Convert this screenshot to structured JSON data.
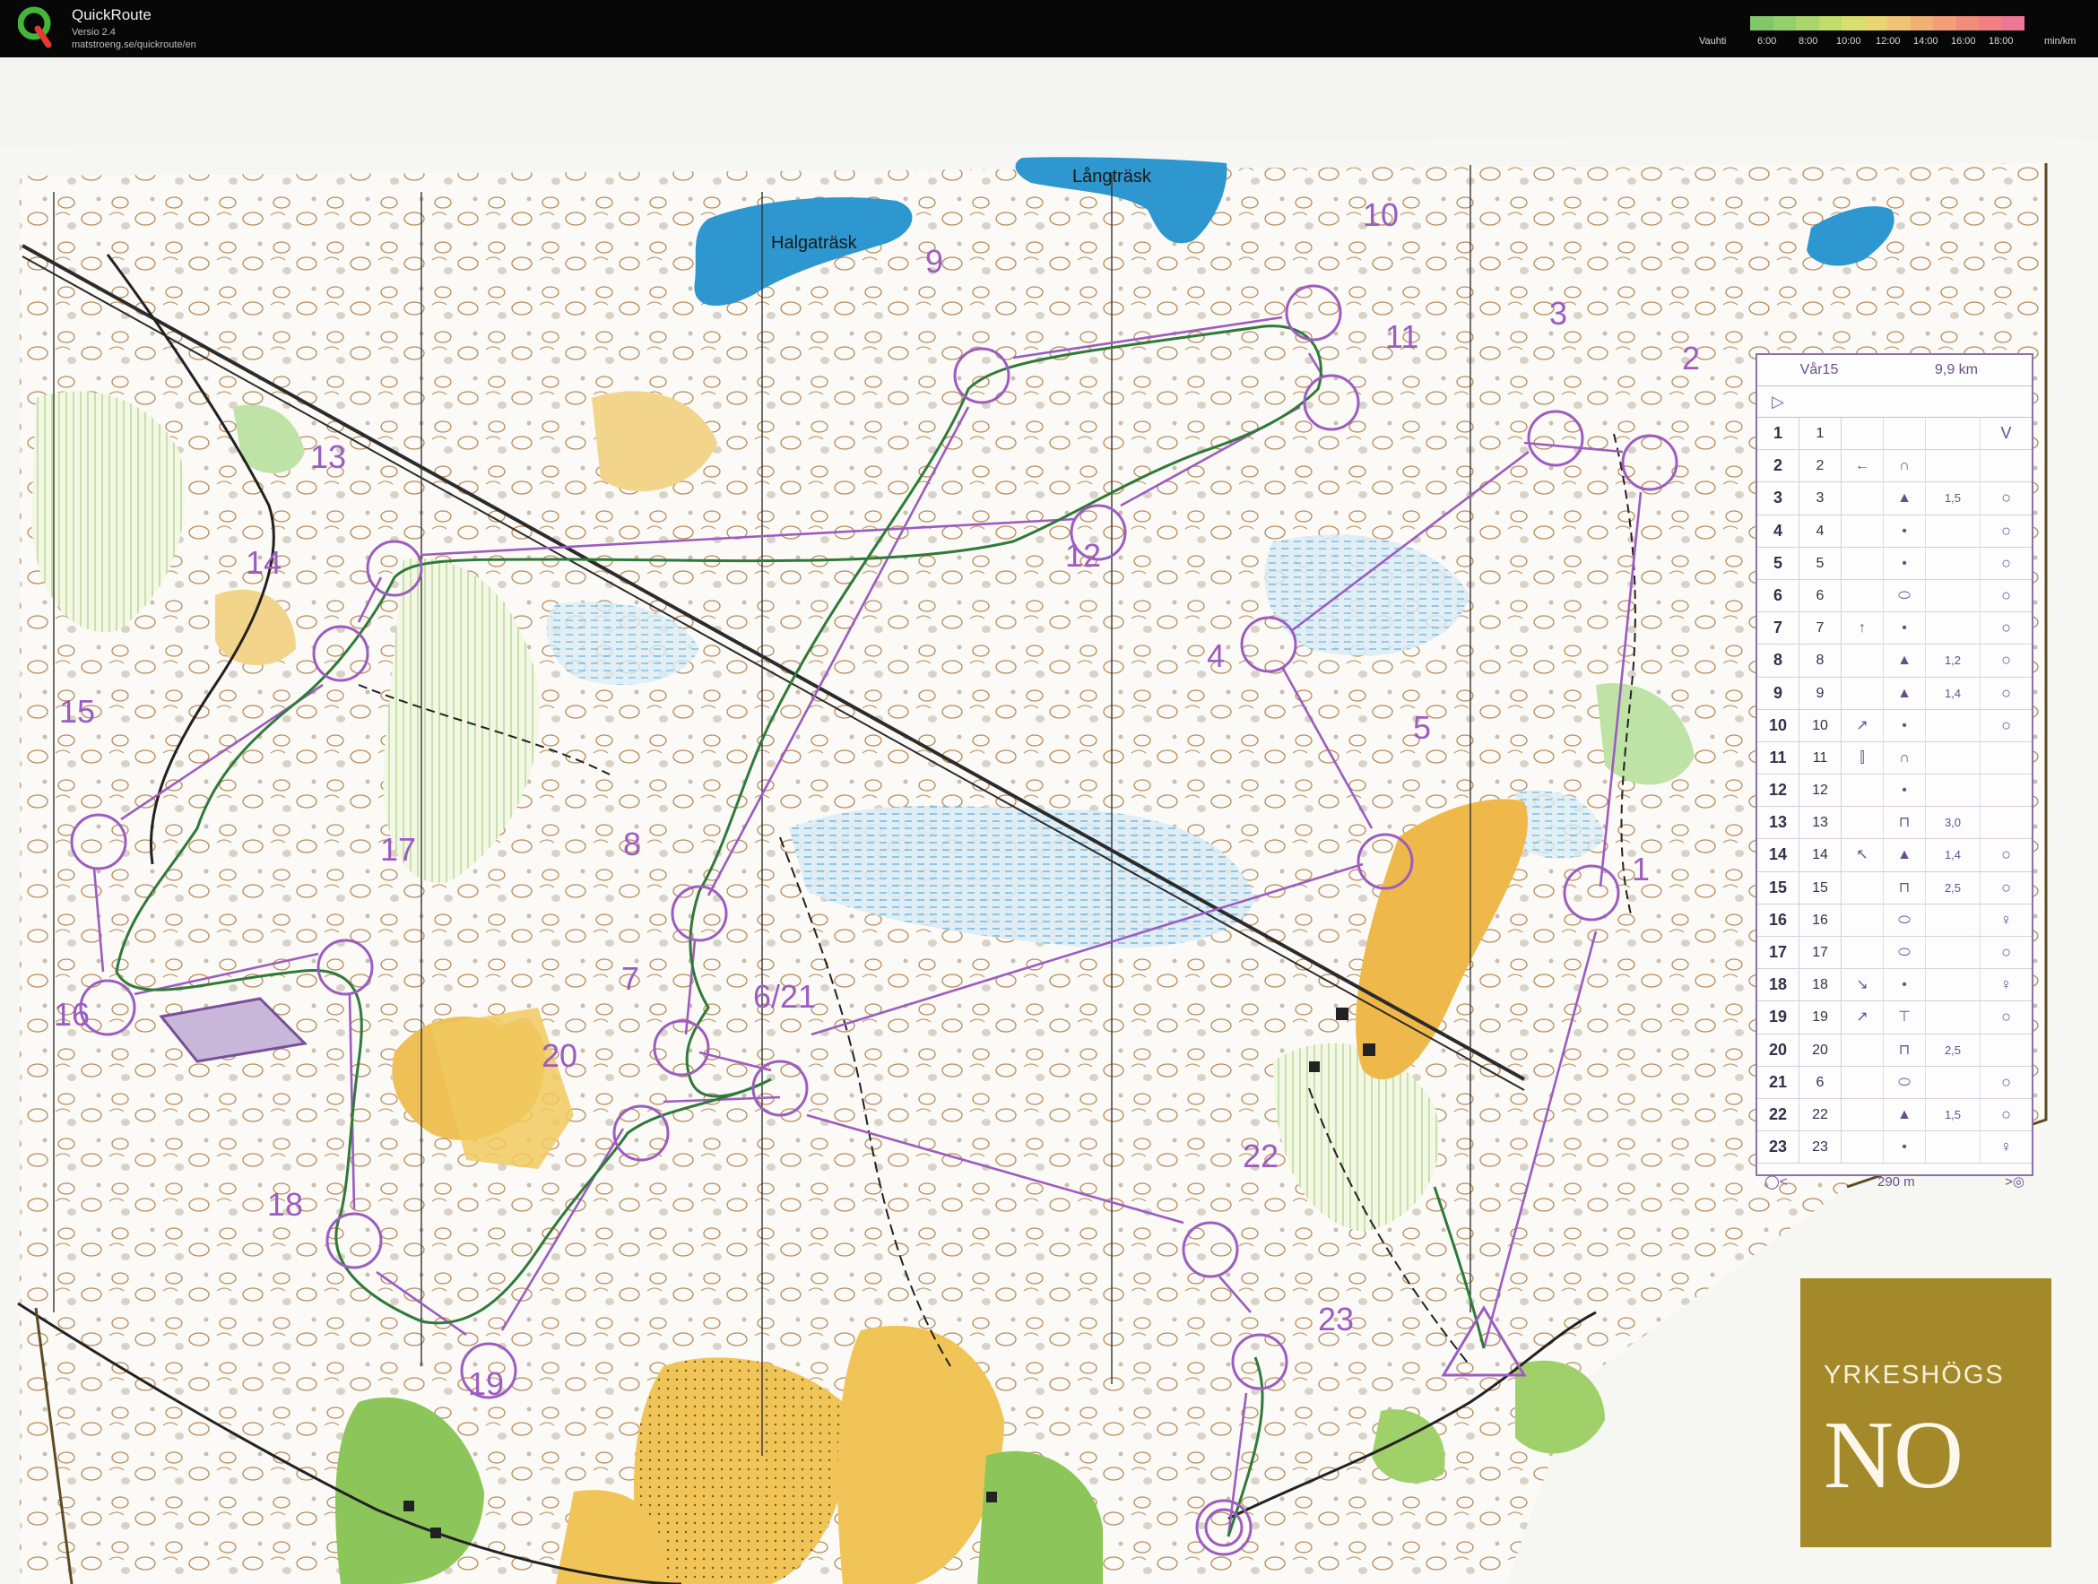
{
  "app": {
    "name": "QuickRoute",
    "version": "Versio 2.4",
    "url": "matstroeng.se/quickroute/en"
  },
  "pace_scale": {
    "label": "Vauhti",
    "ticks": [
      "6:00",
      "8:00",
      "10:00",
      "12:00",
      "14:00",
      "16:00",
      "18:00"
    ],
    "unit": "min/km",
    "colors": [
      "#7ec76a",
      "#93cf6a",
      "#a9d66a",
      "#c2dc6b",
      "#d9df6e",
      "#e8d673",
      "#efc474",
      "#f1b175",
      "#f29e77",
      "#f38d7b",
      "#f17f84",
      "#ee7692"
    ]
  },
  "map": {
    "lake_labels": [
      "Halgaträsk",
      "Långträsk"
    ],
    "controls": [
      "1",
      "2",
      "3",
      "4",
      "5",
      "6/21",
      "7",
      "8",
      "9",
      "10",
      "11",
      "12",
      "13",
      "14",
      "15",
      "16",
      "17",
      "18",
      "19",
      "20",
      "22",
      "23"
    ],
    "colors": {
      "course": "#9c5cc0",
      "route": "#2f7a3a",
      "water": "#3a9fd0",
      "marsh": "#a9d3ea",
      "open": "#e8b74a",
      "vegetation": "#8cc65a"
    }
  },
  "control_table": {
    "course": "Vår15",
    "length": "9,9 km",
    "rows": [
      {
        "no": "1",
        "code": "1",
        "sym": "",
        "feat": "",
        "dim": "",
        "loc": "V"
      },
      {
        "no": "2",
        "code": "2",
        "sym": "←",
        "feat": "∩",
        "dim": "",
        "loc": ""
      },
      {
        "no": "3",
        "code": "3",
        "sym": "",
        "feat": "▲",
        "dim": "1,5",
        "loc": "○"
      },
      {
        "no": "4",
        "code": "4",
        "sym": "",
        "feat": "•",
        "dim": "",
        "loc": "○"
      },
      {
        "no": "5",
        "code": "5",
        "sym": "",
        "feat": "•",
        "dim": "",
        "loc": "○"
      },
      {
        "no": "6",
        "code": "6",
        "sym": "",
        "feat": "⬭",
        "dim": "",
        "loc": "○"
      },
      {
        "no": "7",
        "code": "7",
        "sym": "↑",
        "feat": "•",
        "dim": "",
        "loc": "○"
      },
      {
        "no": "8",
        "code": "8",
        "sym": "",
        "feat": "▲",
        "dim": "1,2",
        "loc": "○"
      },
      {
        "no": "9",
        "code": "9",
        "sym": "",
        "feat": "▲",
        "dim": "1,4",
        "loc": "○"
      },
      {
        "no": "10",
        "code": "10",
        "sym": "↗",
        "feat": "•",
        "dim": "",
        "loc": "○"
      },
      {
        "no": "11",
        "code": "11",
        "sym": "⫿",
        "feat": "∩",
        "dim": "",
        "loc": ""
      },
      {
        "no": "12",
        "code": "12",
        "sym": "",
        "feat": "•",
        "dim": "",
        "loc": ""
      },
      {
        "no": "13",
        "code": "13",
        "sym": "",
        "feat": "⊓",
        "dim": "3,0",
        "loc": ""
      },
      {
        "no": "14",
        "code": "14",
        "sym": "↖",
        "feat": "▲",
        "dim": "1,4",
        "loc": "○"
      },
      {
        "no": "15",
        "code": "15",
        "sym": "",
        "feat": "⊓",
        "dim": "2,5",
        "loc": "○"
      },
      {
        "no": "16",
        "code": "16",
        "sym": "",
        "feat": "⬭",
        "dim": "",
        "loc": "♀"
      },
      {
        "no": "17",
        "code": "17",
        "sym": "",
        "feat": "⬭",
        "dim": "",
        "loc": "○"
      },
      {
        "no": "18",
        "code": "18",
        "sym": "↘",
        "feat": "•",
        "dim": "",
        "loc": "♀"
      },
      {
        "no": "19",
        "code": "19",
        "sym": "↗",
        "feat": "⊤",
        "dim": "",
        "loc": "○"
      },
      {
        "no": "20",
        "code": "20",
        "sym": "",
        "feat": "⊓",
        "dim": "2,5",
        "loc": ""
      },
      {
        "no": "21",
        "code": "6",
        "sym": "",
        "feat": "⬭",
        "dim": "",
        "loc": "○"
      },
      {
        "no": "22",
        "code": "22",
        "sym": "",
        "feat": "▲",
        "dim": "1,5",
        "loc": "○"
      },
      {
        "no": "23",
        "code": "23",
        "sym": "",
        "feat": "•",
        "dim": "",
        "loc": "♀"
      }
    ],
    "finish_distance": "290 m"
  },
  "sponsor": {
    "name": "YRKESHÖGS",
    "mark": "NO"
  }
}
